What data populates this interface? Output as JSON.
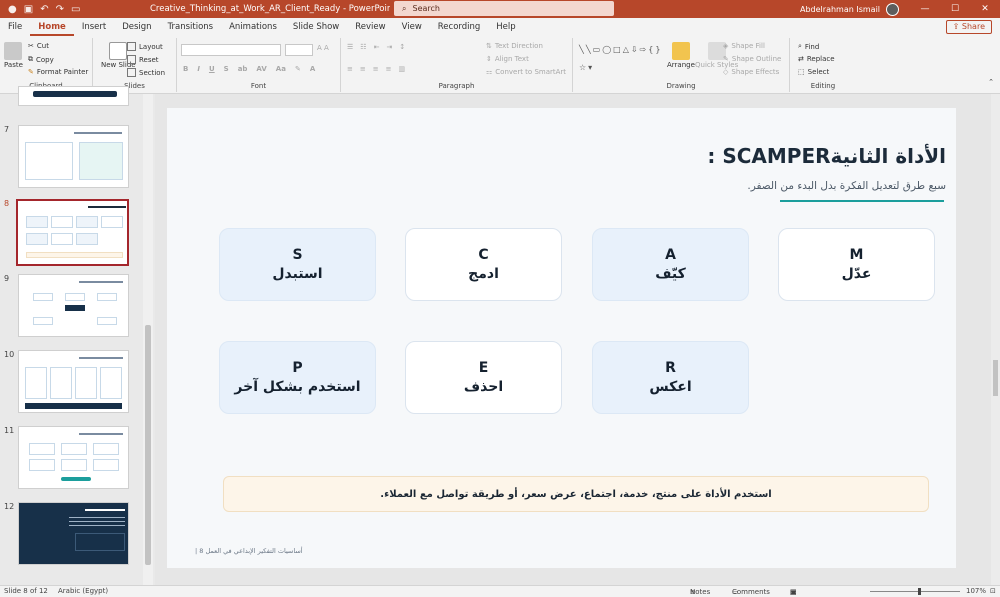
{
  "titlebar": {
    "doc_title": "Creative_Thinking_at_Work_AR_Client_Ready  -  PowerPoint",
    "search_placeholder": "Search",
    "user_name": "Abdelrahman Ismail"
  },
  "tabs": [
    "File",
    "Home",
    "Insert",
    "Design",
    "Transitions",
    "Animations",
    "Slide Show",
    "Review",
    "View",
    "Recording",
    "Help"
  ],
  "active_tab": "Home",
  "share_label": "Share",
  "ribbon": {
    "clipboard": {
      "paste": "Paste",
      "cut": "Cut",
      "copy": "Copy",
      "format_painter": "Format Painter",
      "group": "Clipboard"
    },
    "slides": {
      "new_slide": "New Slide",
      "layout": "Layout",
      "reset": "Reset",
      "section": "Section",
      "group": "Slides"
    },
    "font": {
      "group": "Font"
    },
    "paragraph": {
      "text_direction": "Text Direction",
      "align_text": "Align Text",
      "smartart": "Convert to SmartArt",
      "group": "Paragraph"
    },
    "drawing": {
      "arrange": "Arrange",
      "quick_styles": "Quick Styles",
      "shape_fill": "Shape Fill",
      "shape_outline": "Shape Outline",
      "shape_effects": "Shape Effects",
      "group": "Drawing"
    },
    "editing": {
      "find": "Find",
      "replace": "Replace",
      "select": "Select",
      "group": "Editing"
    }
  },
  "thumbnails": [
    {
      "num": "7"
    },
    {
      "num": "8",
      "title": "الأداة الثانيةSCAMPER :"
    },
    {
      "num": "9"
    },
    {
      "num": "10"
    },
    {
      "num": "11"
    },
    {
      "num": "12"
    }
  ],
  "slide": {
    "title": "الأداة الثانيةSCAMPER :",
    "subtitle": "سبع طرق لتعديل الفكرة بدل البدء من الصفر.",
    "cards": [
      {
        "letter": "M",
        "word": "عدّل"
      },
      {
        "letter": "A",
        "word": "كيّف"
      },
      {
        "letter": "C",
        "word": "ادمج"
      },
      {
        "letter": "S",
        "word": "استبدل"
      },
      {
        "letter": "R",
        "word": "اعكس"
      },
      {
        "letter": "E",
        "word": "احذف"
      },
      {
        "letter": "P",
        "word": "استخدم بشكل آخر"
      }
    ],
    "note": "استخدم الأداة على منتج، خدمة، اجتماع، عرض سعر، أو طريقة تواصل مع العملاء.",
    "footer": "أساسيات التفكير الإبداعي في العمل 8 |"
  },
  "status": {
    "slide_info": "Slide 8 of 12",
    "language": "Arabic (Egypt)",
    "notes": "Notes",
    "comments": "Comments",
    "zoom": "107%"
  },
  "colors": {
    "brand": "#b7472a",
    "accent_teal": "#1b9e9c",
    "card_blue": "#e8f1fb",
    "note_bg": "#fdf5e9"
  }
}
